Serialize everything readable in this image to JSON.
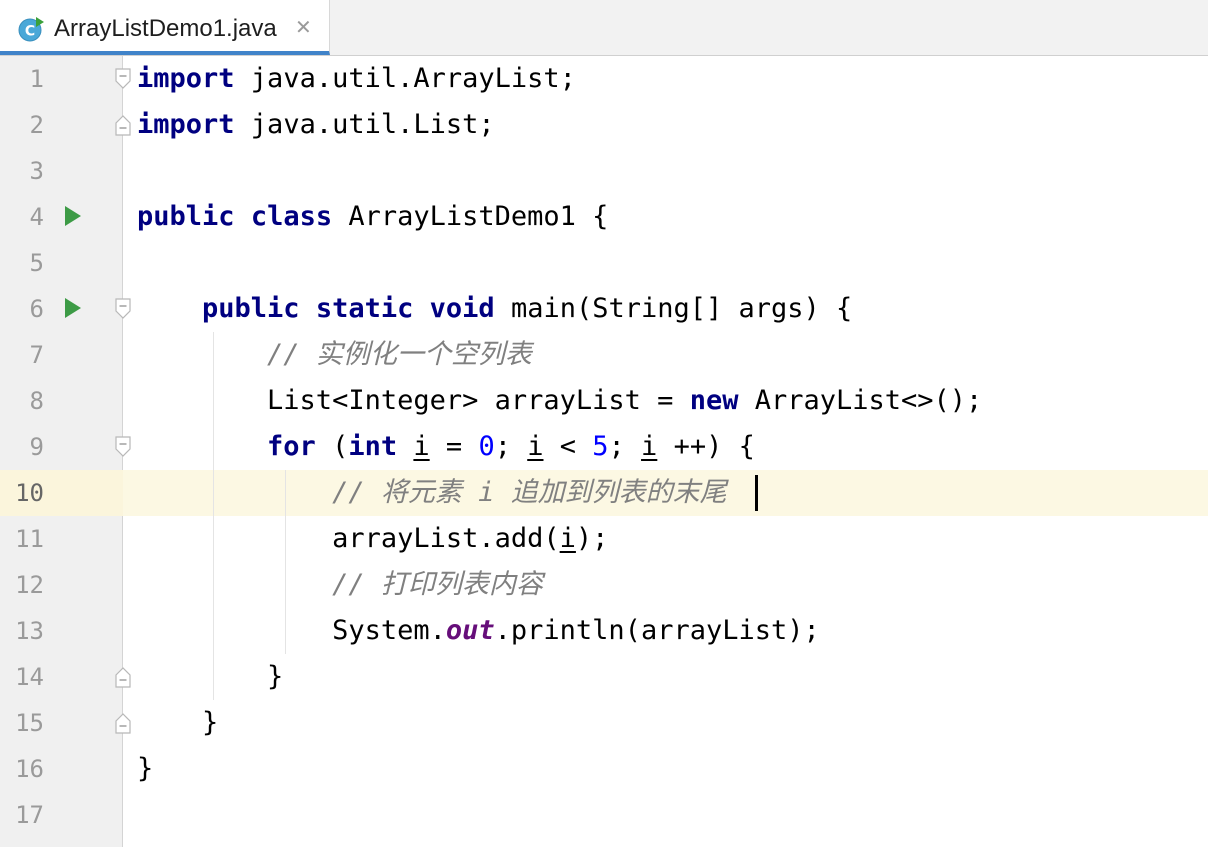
{
  "tab": {
    "title": "ArrayListDemo1.java",
    "close": "✕",
    "icon": "java-class-icon"
  },
  "colors": {
    "keyword": "#000080",
    "comment": "#808080",
    "number": "#0000ff",
    "static_field": "#660e7a",
    "current_line": "#fcf8e3"
  },
  "current_line": 10,
  "lines": [
    {
      "num": "1",
      "tokens": [
        {
          "t": "import",
          "c": "kw"
        },
        {
          "t": " java.util.ArrayList;"
        }
      ]
    },
    {
      "num": "2",
      "tokens": [
        {
          "t": "import",
          "c": "kw"
        },
        {
          "t": " java.util.List;"
        }
      ]
    },
    {
      "num": "3",
      "tokens": []
    },
    {
      "num": "4",
      "tokens": [
        {
          "t": "public",
          "c": "kw"
        },
        {
          "t": " "
        },
        {
          "t": "class",
          "c": "kw"
        },
        {
          "t": " ArrayListDemo1 {"
        }
      ]
    },
    {
      "num": "5",
      "tokens": []
    },
    {
      "num": "6",
      "tokens": [
        {
          "t": "    "
        },
        {
          "t": "public",
          "c": "kw"
        },
        {
          "t": " "
        },
        {
          "t": "static",
          "c": "kw"
        },
        {
          "t": " "
        },
        {
          "t": "void",
          "c": "kw"
        },
        {
          "t": " main(String[] args) {"
        }
      ]
    },
    {
      "num": "7",
      "tokens": [
        {
          "t": "        "
        },
        {
          "t": "// 实例化一个空列表",
          "c": "cm"
        }
      ]
    },
    {
      "num": "8",
      "tokens": [
        {
          "t": "        List<Integer> arrayList = "
        },
        {
          "t": "new",
          "c": "kw"
        },
        {
          "t": " ArrayList<>();"
        }
      ]
    },
    {
      "num": "9",
      "tokens": [
        {
          "t": "        "
        },
        {
          "t": "for",
          "c": "kw"
        },
        {
          "t": " ("
        },
        {
          "t": "int",
          "c": "kw"
        },
        {
          "t": " "
        },
        {
          "t": "i",
          "c": "ul"
        },
        {
          "t": " = "
        },
        {
          "t": "0",
          "c": "num"
        },
        {
          "t": "; "
        },
        {
          "t": "i",
          "c": "ul"
        },
        {
          "t": " < "
        },
        {
          "t": "5",
          "c": "num"
        },
        {
          "t": "; "
        },
        {
          "t": "i",
          "c": "ul"
        },
        {
          "t": " ++) {"
        }
      ]
    },
    {
      "num": "10",
      "tokens": [
        {
          "t": "            "
        },
        {
          "t": "// 将元素 i 追加到列表的末尾",
          "c": "cm"
        }
      ]
    },
    {
      "num": "11",
      "tokens": [
        {
          "t": "            arrayList.add("
        },
        {
          "t": "i",
          "c": "ul"
        },
        {
          "t": ");"
        }
      ]
    },
    {
      "num": "12",
      "tokens": [
        {
          "t": "            "
        },
        {
          "t": "// 打印列表内容",
          "c": "cm"
        }
      ]
    },
    {
      "num": "13",
      "tokens": [
        {
          "t": "            System."
        },
        {
          "t": "out",
          "c": "field"
        },
        {
          "t": ".println(arrayList);"
        }
      ]
    },
    {
      "num": "14",
      "tokens": [
        {
          "t": "        }"
        }
      ]
    },
    {
      "num": "15",
      "tokens": [
        {
          "t": "    }"
        }
      ]
    },
    {
      "num": "16",
      "tokens": [
        {
          "t": "}"
        }
      ]
    },
    {
      "num": "17",
      "tokens": []
    }
  ],
  "gutter_markers": {
    "run": [
      "4",
      "6"
    ],
    "fold_open": [
      "1",
      "6",
      "9"
    ],
    "fold_close": [
      "2",
      "14",
      "15"
    ]
  }
}
